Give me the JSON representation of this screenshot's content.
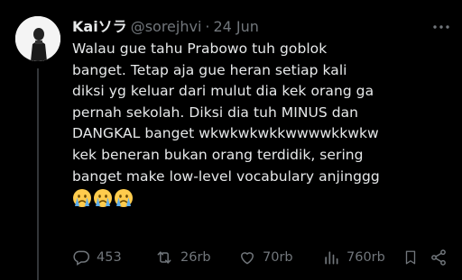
{
  "tweet": {
    "author_name": "Kaiソラ",
    "handle": "@sorejhvi",
    "separator": "·",
    "date": "24 Jun",
    "lines": [
      "Walau gue tahu Prabowo tuh goblok",
      "banget. Tetap aja gue heran setiap kali",
      "diksi yg keluar dari mulut dia kek orang ga",
      "pernah sekolah. Diksi dia tuh MINUS dan",
      "DANGKAL banget wkwkwkwkkwwwwkkwkw",
      "kek beneran bukan orang terdidik, sering",
      "banget make low-level vocabulary anjinggg"
    ],
    "emojis": [
      "crying-face",
      "crying-face",
      "crying-face"
    ]
  },
  "actions": {
    "replies": "453",
    "reposts": "26rb",
    "likes": "70rb",
    "views": "760rb"
  },
  "icons": {
    "more": "more-icon",
    "reply": "reply-icon",
    "repost": "repost-icon",
    "like": "heart-icon",
    "views": "views-icon",
    "bookmark": "bookmark-icon",
    "share": "share-icon"
  },
  "colors": {
    "background": "#000000",
    "text": "#e7e9ea",
    "muted": "#71767b",
    "divider": "#333639"
  }
}
